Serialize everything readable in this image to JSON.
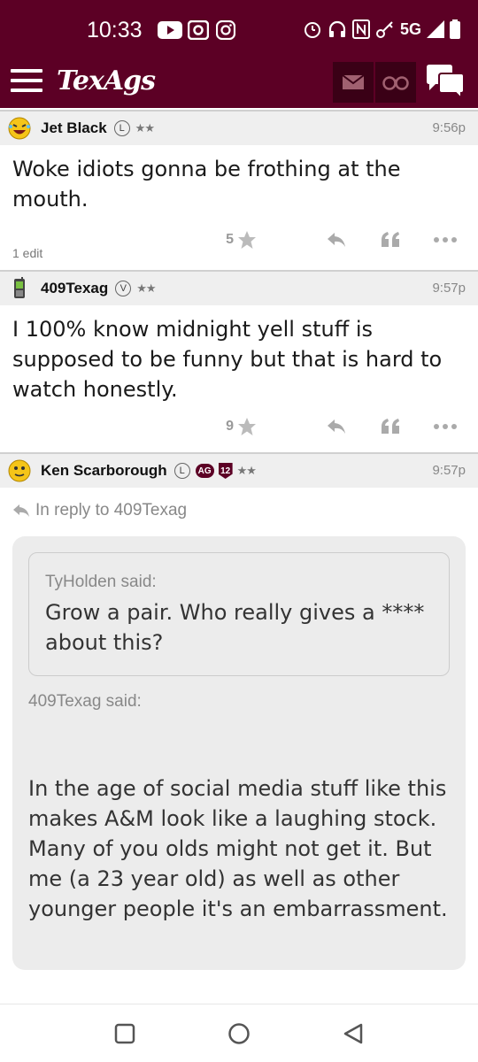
{
  "status": {
    "time": "10:33",
    "network": "5G"
  },
  "app": {
    "title": "TexAgs"
  },
  "posts": [
    {
      "username": "Jet Black",
      "badge": "L",
      "stars": "★★",
      "time": "9:56p",
      "body": "Woke idiots gonna be frothing at the mouth.",
      "edit_note": "1 edit",
      "rating": "5"
    },
    {
      "username": "409Texag",
      "badge": "V",
      "stars": "★★",
      "time": "9:57p",
      "body": "I 100% know midnight yell stuff is supposed to be funny but that is hard to watch honestly.",
      "rating": "9"
    },
    {
      "username": "Ken Scarborough",
      "badge": "L",
      "badge_ag": "AG",
      "badge_num": "12",
      "stars": "★★",
      "time": "9:57p",
      "reply_to": "In reply to 409Texag",
      "quote_inner_author": "TyHolden said:",
      "quote_inner_text": "Grow a pair. Who really gives a **** about this?",
      "quote_author": "409Texag said:",
      "quote_text": "In the age of social media stuff like this makes A&M look like a laughing stock. Many of you olds might not get it. But me (a 23 year old) as well as other younger people it's an embarrassment."
    }
  ],
  "colors": {
    "brand": "#5c0025",
    "header_bg": "#efefef",
    "quote_bg": "#ececec"
  }
}
